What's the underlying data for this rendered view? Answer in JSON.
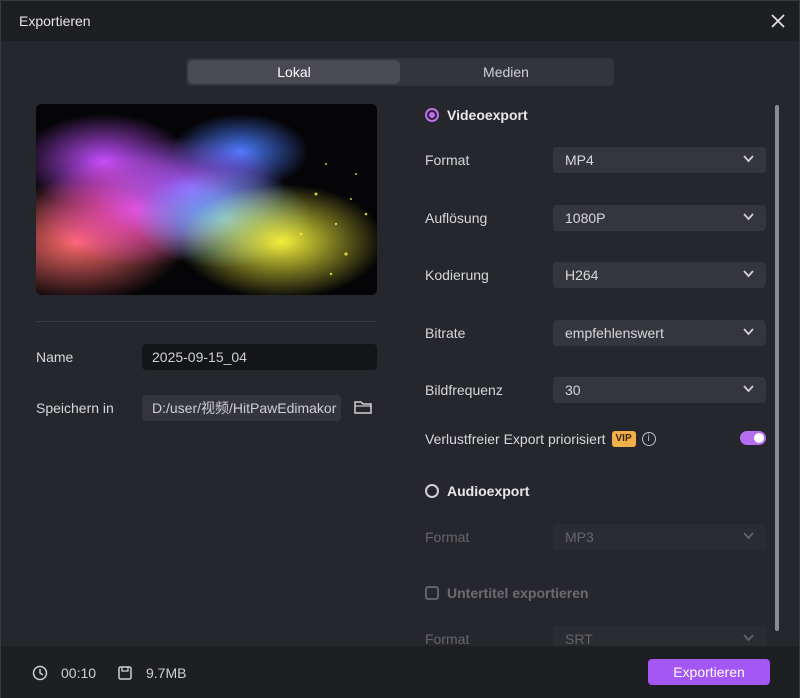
{
  "window": {
    "title": "Exportieren"
  },
  "tabs": [
    {
      "label": "Lokal",
      "active": true
    },
    {
      "label": "Medien",
      "active": false
    }
  ],
  "left": {
    "name_label": "Name",
    "name_value": "2025-09-15_04",
    "save_label": "Speichern in",
    "save_path": "D:/user/视频/HitPawEdimakor"
  },
  "video": {
    "title": "Videoexport",
    "format": {
      "label": "Format",
      "value": "MP4"
    },
    "resolution": {
      "label": "Auflösung",
      "value": "1080P"
    },
    "encoding": {
      "label": "Kodierung",
      "value": "H264"
    },
    "bitrate": {
      "label": "Bitrate",
      "value": "empfehlenswert"
    },
    "framerate": {
      "label": "Bildfrequenz",
      "value": "30"
    },
    "lossless": {
      "label": "Verlustfreier Export priorisiert",
      "badge": "VIP",
      "enabled": true
    }
  },
  "audio": {
    "title": "Audioexport",
    "format": {
      "label": "Format",
      "value": "MP3"
    }
  },
  "subtitle": {
    "title": "Untertitel exportieren",
    "format": {
      "label": "Format",
      "value": "SRT"
    }
  },
  "footer": {
    "duration": "00:10",
    "size": "9.7MB",
    "export_label": "Exportieren"
  },
  "colors": {
    "accent": "#a557f5",
    "vip": "#f2b04a"
  }
}
